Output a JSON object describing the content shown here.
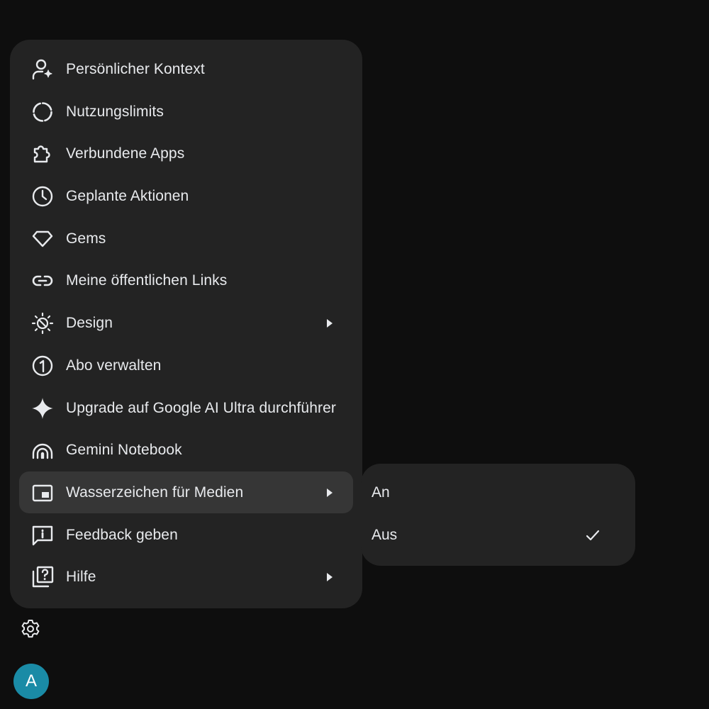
{
  "menu": {
    "items": [
      {
        "label": "Persönlicher Kontext",
        "icon": "person-sparkle-icon",
        "submenu": false
      },
      {
        "label": "Nutzungslimits",
        "icon": "dashed-circle-icon",
        "submenu": false
      },
      {
        "label": "Verbundene Apps",
        "icon": "puzzle-icon",
        "submenu": false
      },
      {
        "label": "Geplante Aktionen",
        "icon": "clock-icon",
        "submenu": false
      },
      {
        "label": "Gems",
        "icon": "gem-icon",
        "submenu": false
      },
      {
        "label": "Meine öffentlichen Links",
        "icon": "link-icon",
        "submenu": false
      },
      {
        "label": "Design",
        "icon": "theme-icon",
        "submenu": true
      },
      {
        "label": "Abo verwalten",
        "icon": "subscription-icon",
        "submenu": false
      },
      {
        "label": "Upgrade auf Google AI Ultra durchführer",
        "icon": "sparkle-icon",
        "submenu": false
      },
      {
        "label": "Gemini Notebook",
        "icon": "notebook-icon",
        "submenu": false
      },
      {
        "label": "Wasserzeichen für Medien",
        "icon": "picture-in-picture-icon",
        "submenu": true
      },
      {
        "label": "Feedback geben",
        "icon": "feedback-icon",
        "submenu": false
      },
      {
        "label": "Hilfe",
        "icon": "help-icon",
        "submenu": true
      }
    ]
  },
  "watermark_submenu": {
    "options": [
      {
        "label": "An",
        "selected": false
      },
      {
        "label": "Aus",
        "selected": true
      }
    ]
  },
  "avatar": {
    "initial": "A",
    "color": "#1a8ba6"
  },
  "colors": {
    "background": "#0e0e0e",
    "menu": "#232323",
    "highlight": "#363636",
    "text": "#e8eaed"
  }
}
